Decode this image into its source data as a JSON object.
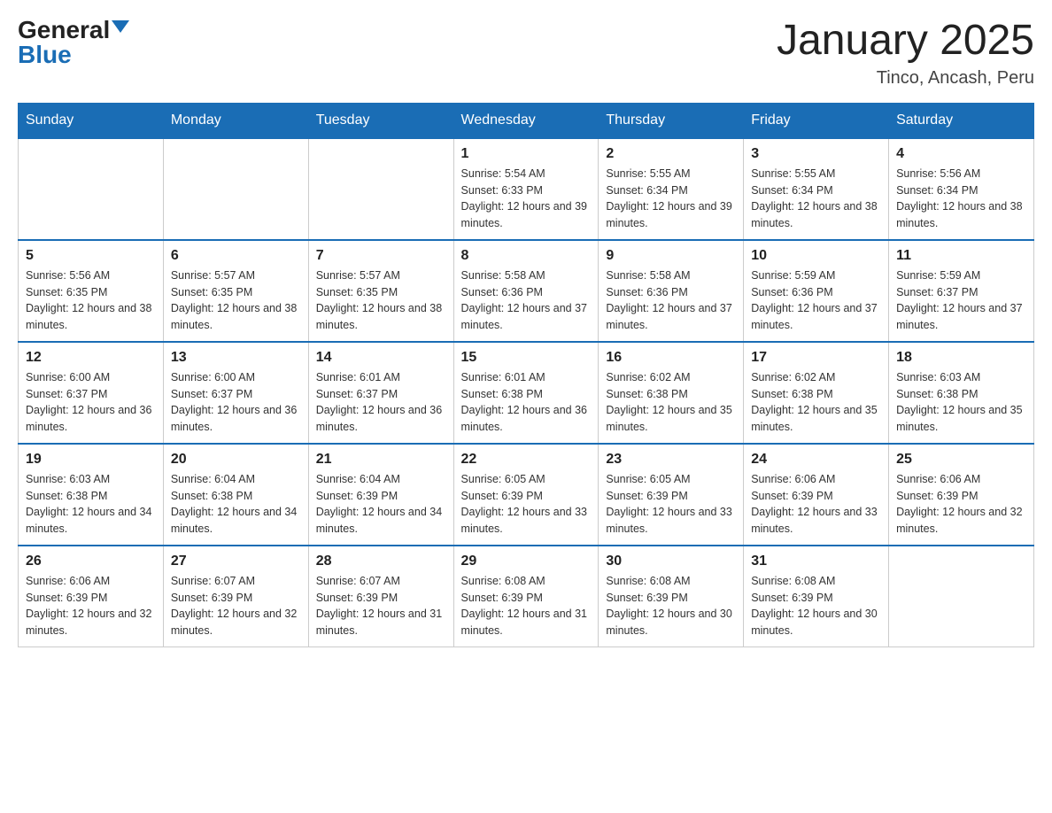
{
  "header": {
    "logo_general": "General",
    "logo_blue": "Blue",
    "month_title": "January 2025",
    "location": "Tinco, Ancash, Peru"
  },
  "days_of_week": [
    "Sunday",
    "Monday",
    "Tuesday",
    "Wednesday",
    "Thursday",
    "Friday",
    "Saturday"
  ],
  "weeks": [
    [
      {
        "day": "",
        "info": ""
      },
      {
        "day": "",
        "info": ""
      },
      {
        "day": "",
        "info": ""
      },
      {
        "day": "1",
        "info": "Sunrise: 5:54 AM\nSunset: 6:33 PM\nDaylight: 12 hours and 39 minutes."
      },
      {
        "day": "2",
        "info": "Sunrise: 5:55 AM\nSunset: 6:34 PM\nDaylight: 12 hours and 39 minutes."
      },
      {
        "day": "3",
        "info": "Sunrise: 5:55 AM\nSunset: 6:34 PM\nDaylight: 12 hours and 38 minutes."
      },
      {
        "day": "4",
        "info": "Sunrise: 5:56 AM\nSunset: 6:34 PM\nDaylight: 12 hours and 38 minutes."
      }
    ],
    [
      {
        "day": "5",
        "info": "Sunrise: 5:56 AM\nSunset: 6:35 PM\nDaylight: 12 hours and 38 minutes."
      },
      {
        "day": "6",
        "info": "Sunrise: 5:57 AM\nSunset: 6:35 PM\nDaylight: 12 hours and 38 minutes."
      },
      {
        "day": "7",
        "info": "Sunrise: 5:57 AM\nSunset: 6:35 PM\nDaylight: 12 hours and 38 minutes."
      },
      {
        "day": "8",
        "info": "Sunrise: 5:58 AM\nSunset: 6:36 PM\nDaylight: 12 hours and 37 minutes."
      },
      {
        "day": "9",
        "info": "Sunrise: 5:58 AM\nSunset: 6:36 PM\nDaylight: 12 hours and 37 minutes."
      },
      {
        "day": "10",
        "info": "Sunrise: 5:59 AM\nSunset: 6:36 PM\nDaylight: 12 hours and 37 minutes."
      },
      {
        "day": "11",
        "info": "Sunrise: 5:59 AM\nSunset: 6:37 PM\nDaylight: 12 hours and 37 minutes."
      }
    ],
    [
      {
        "day": "12",
        "info": "Sunrise: 6:00 AM\nSunset: 6:37 PM\nDaylight: 12 hours and 36 minutes."
      },
      {
        "day": "13",
        "info": "Sunrise: 6:00 AM\nSunset: 6:37 PM\nDaylight: 12 hours and 36 minutes."
      },
      {
        "day": "14",
        "info": "Sunrise: 6:01 AM\nSunset: 6:37 PM\nDaylight: 12 hours and 36 minutes."
      },
      {
        "day": "15",
        "info": "Sunrise: 6:01 AM\nSunset: 6:38 PM\nDaylight: 12 hours and 36 minutes."
      },
      {
        "day": "16",
        "info": "Sunrise: 6:02 AM\nSunset: 6:38 PM\nDaylight: 12 hours and 35 minutes."
      },
      {
        "day": "17",
        "info": "Sunrise: 6:02 AM\nSunset: 6:38 PM\nDaylight: 12 hours and 35 minutes."
      },
      {
        "day": "18",
        "info": "Sunrise: 6:03 AM\nSunset: 6:38 PM\nDaylight: 12 hours and 35 minutes."
      }
    ],
    [
      {
        "day": "19",
        "info": "Sunrise: 6:03 AM\nSunset: 6:38 PM\nDaylight: 12 hours and 34 minutes."
      },
      {
        "day": "20",
        "info": "Sunrise: 6:04 AM\nSunset: 6:38 PM\nDaylight: 12 hours and 34 minutes."
      },
      {
        "day": "21",
        "info": "Sunrise: 6:04 AM\nSunset: 6:39 PM\nDaylight: 12 hours and 34 minutes."
      },
      {
        "day": "22",
        "info": "Sunrise: 6:05 AM\nSunset: 6:39 PM\nDaylight: 12 hours and 33 minutes."
      },
      {
        "day": "23",
        "info": "Sunrise: 6:05 AM\nSunset: 6:39 PM\nDaylight: 12 hours and 33 minutes."
      },
      {
        "day": "24",
        "info": "Sunrise: 6:06 AM\nSunset: 6:39 PM\nDaylight: 12 hours and 33 minutes."
      },
      {
        "day": "25",
        "info": "Sunrise: 6:06 AM\nSunset: 6:39 PM\nDaylight: 12 hours and 32 minutes."
      }
    ],
    [
      {
        "day": "26",
        "info": "Sunrise: 6:06 AM\nSunset: 6:39 PM\nDaylight: 12 hours and 32 minutes."
      },
      {
        "day": "27",
        "info": "Sunrise: 6:07 AM\nSunset: 6:39 PM\nDaylight: 12 hours and 32 minutes."
      },
      {
        "day": "28",
        "info": "Sunrise: 6:07 AM\nSunset: 6:39 PM\nDaylight: 12 hours and 31 minutes."
      },
      {
        "day": "29",
        "info": "Sunrise: 6:08 AM\nSunset: 6:39 PM\nDaylight: 12 hours and 31 minutes."
      },
      {
        "day": "30",
        "info": "Sunrise: 6:08 AM\nSunset: 6:39 PM\nDaylight: 12 hours and 30 minutes."
      },
      {
        "day": "31",
        "info": "Sunrise: 6:08 AM\nSunset: 6:39 PM\nDaylight: 12 hours and 30 minutes."
      },
      {
        "day": "",
        "info": ""
      }
    ]
  ]
}
